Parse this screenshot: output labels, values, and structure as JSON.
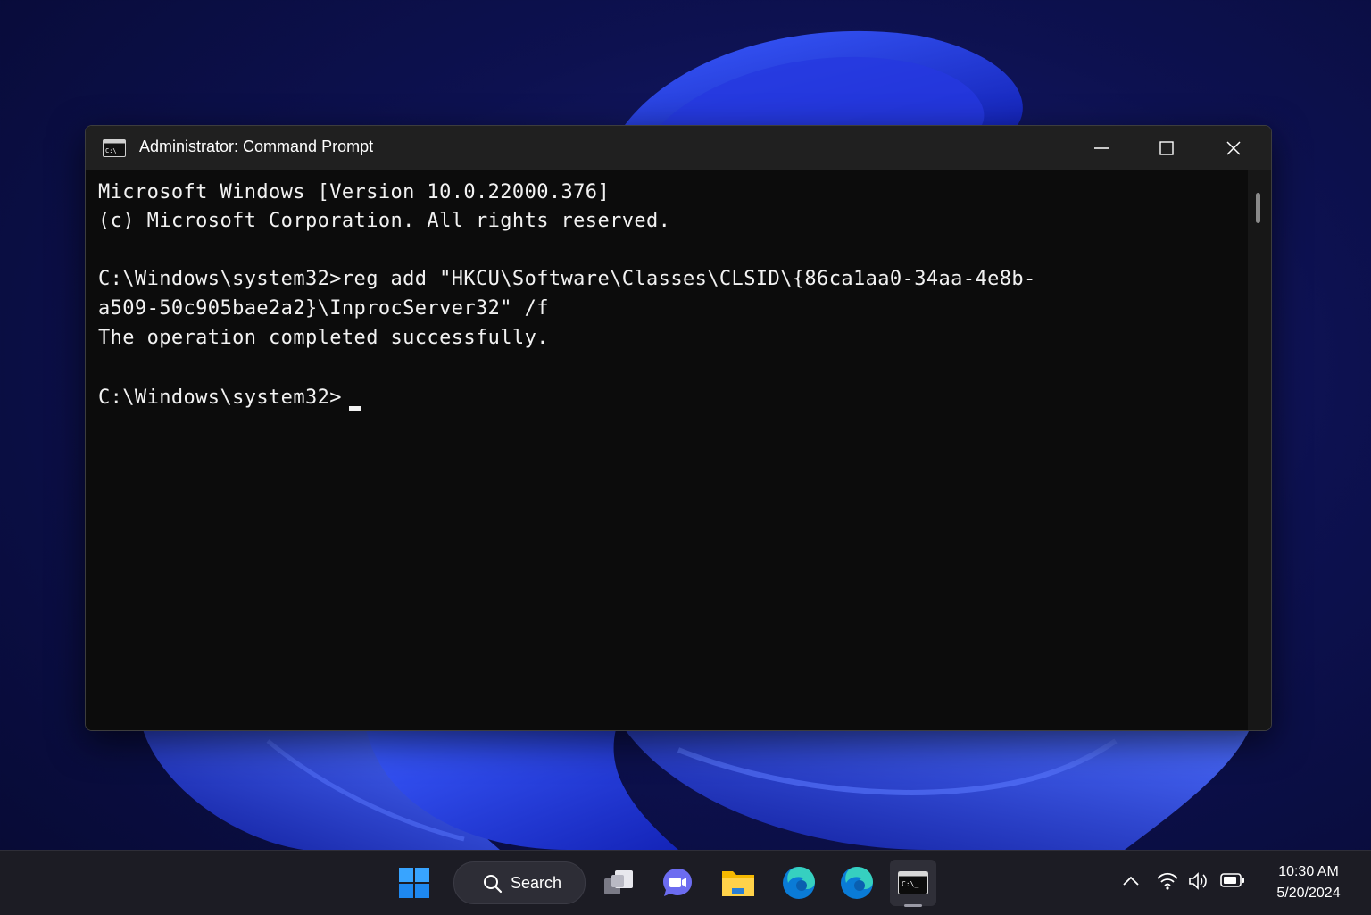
{
  "window": {
    "title": "Administrator: Command Prompt",
    "app_icon_text": "C:\\_"
  },
  "console": {
    "lines": [
      "Microsoft Windows [Version 10.0.22000.376]",
      "(c) Microsoft Corporation. All rights reserved.",
      "",
      "C:\\Windows\\system32>reg add \"HKCU\\Software\\Classes\\CLSID\\{86ca1aa0-34aa-4e8b-",
      "a509-50c905bae2a2}\\InprocServer32\" /f",
      "The operation completed successfully.",
      "",
      "C:\\Windows\\system32>"
    ]
  },
  "taskbar": {
    "search_label": "Search",
    "apps": [
      "start-icon",
      "task-view-icon",
      "chat-icon",
      "file-explorer-icon",
      "edge-icon",
      "edge-icon",
      "command-prompt-icon"
    ],
    "active_app": "command-prompt-icon"
  },
  "tray": {
    "time": "10:30 AM",
    "date": "5/20/2024",
    "icons": [
      "chevron-up-icon",
      "wifi-icon",
      "volume-icon",
      "battery-icon"
    ]
  },
  "colors": {
    "console_bg": "#0c0c0c",
    "console_text": "#f2f2f2",
    "titlebar_bg": "#202020",
    "taskbar_bg": "#1c1c24",
    "wallpaper_accent": "#2a3cff"
  }
}
